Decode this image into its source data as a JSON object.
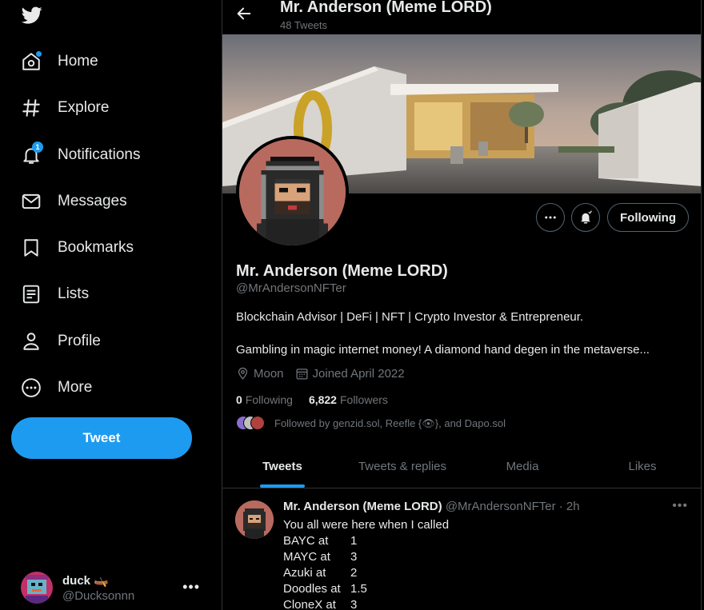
{
  "sidebar": {
    "nav": [
      {
        "label": "Home",
        "icon": "home-icon"
      },
      {
        "label": "Explore",
        "icon": "hashtag-icon"
      },
      {
        "label": "Notifications",
        "icon": "bell-icon",
        "badge": "1"
      },
      {
        "label": "Messages",
        "icon": "envelope-icon"
      },
      {
        "label": "Bookmarks",
        "icon": "bookmark-icon"
      },
      {
        "label": "Lists",
        "icon": "list-icon"
      },
      {
        "label": "Profile",
        "icon": "person-icon"
      },
      {
        "label": "More",
        "icon": "more-circle-icon"
      }
    ],
    "tweet_button": "Tweet",
    "account": {
      "name": "duck 🛶",
      "handle": "@Ducksonnn"
    }
  },
  "header": {
    "title": "Mr. Anderson (Meme LORD)",
    "tweet_count": "48 Tweets"
  },
  "profile": {
    "name": "Mr. Anderson (Meme LORD)",
    "handle": "@MrAndersonNFTer",
    "bio_line1": "Blockchain Advisor | DeFi | NFT | Crypto Investor & Entrepreneur.",
    "bio_line2": "Gambling in magic internet money! A diamond hand degen in the metaverse...",
    "location": "Moon",
    "joined": "Joined April 2022",
    "following_count": "0",
    "following_label": "Following",
    "followers_count": "6,822",
    "followers_label": "Followers",
    "followed_by": "Followed by genzid.sol, Reefle {👁}, and Dapo.sol",
    "following_button": "Following"
  },
  "tabs": [
    {
      "label": "Tweets",
      "active": true
    },
    {
      "label": "Tweets & replies",
      "active": false
    },
    {
      "label": "Media",
      "active": false
    },
    {
      "label": "Likes",
      "active": false
    }
  ],
  "tweet": {
    "name": "Mr. Anderson (Meme LORD)",
    "handle": "@MrAndersonNFTer",
    "time": "· 2h",
    "intro": "You all were here when I called",
    "rows": [
      {
        "coin": "BAYC at",
        "value": "1"
      },
      {
        "coin": "MAYC at",
        "value": "3"
      },
      {
        "coin": "Azuki at",
        "value": "2"
      },
      {
        "coin": "Doodles at",
        "value": "1.5"
      },
      {
        "coin": "CloneX at",
        "value": "3"
      }
    ]
  },
  "colors": {
    "accent": "#1d9bf0",
    "background": "#000000",
    "muted": "#71767b",
    "border": "#2f3336"
  }
}
